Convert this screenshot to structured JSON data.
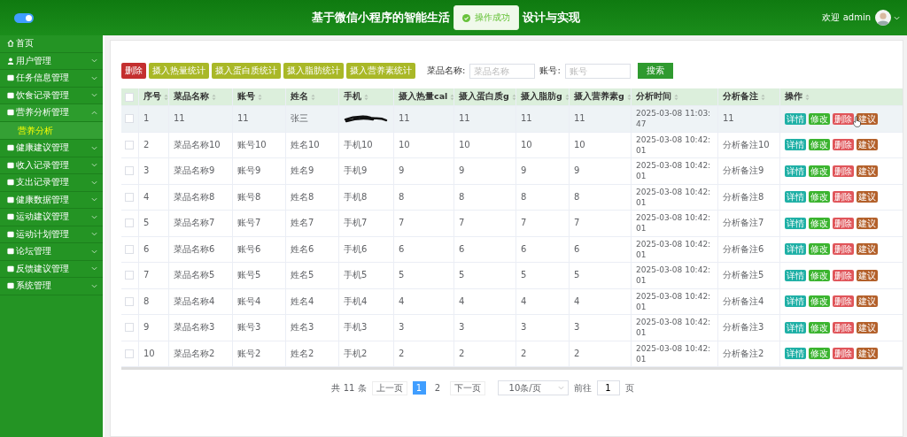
{
  "header": {
    "toggle_on": true,
    "title_left": "基于微信小程序的智能生活",
    "title_right": "设计与实现",
    "toast": "操作成功",
    "welcome": "欢迎 admin"
  },
  "sidebar": {
    "items": [
      {
        "label": "首页",
        "kind": "link"
      },
      {
        "label": "用户管理",
        "kind": "group",
        "expanded": false
      },
      {
        "label": "任务信息管理",
        "kind": "group",
        "expanded": false
      },
      {
        "label": "饮食记录管理",
        "kind": "group",
        "expanded": false
      },
      {
        "label": "营养分析管理",
        "kind": "group",
        "expanded": true,
        "children": [
          {
            "label": "营养分析",
            "selected": true
          }
        ]
      },
      {
        "label": "健康建议管理",
        "kind": "group",
        "expanded": false
      },
      {
        "label": "收入记录管理",
        "kind": "group",
        "expanded": false
      },
      {
        "label": "支出记录管理",
        "kind": "group",
        "expanded": false
      },
      {
        "label": "健康数据管理",
        "kind": "group",
        "expanded": false
      },
      {
        "label": "运动建议管理",
        "kind": "group",
        "expanded": false
      },
      {
        "label": "运动计划管理",
        "kind": "group",
        "expanded": false
      },
      {
        "label": "论坛管理",
        "kind": "group",
        "expanded": false
      },
      {
        "label": "反馈建议管理",
        "kind": "group",
        "expanded": false
      },
      {
        "label": "系统管理",
        "kind": "group",
        "expanded": false
      }
    ]
  },
  "toolbar": {
    "buttons": [
      {
        "label": "删除",
        "color": "#c42f2f"
      },
      {
        "label": "摄入热量统计",
        "color": "#a9b827"
      },
      {
        "label": "摄入蛋白质统计",
        "color": "#a9b827"
      },
      {
        "label": "摄入脂肪统计",
        "color": "#a9b827"
      },
      {
        "label": "摄入营养素统计",
        "color": "#a9b827"
      }
    ],
    "filters": [
      {
        "label": "菜品名称:",
        "placeholder": "菜品名称"
      },
      {
        "label": "账号:",
        "placeholder": "账号"
      }
    ],
    "search_button": "搜索"
  },
  "table": {
    "select_all_checked": false,
    "columns": [
      "序号",
      "菜品名称",
      "账号",
      "姓名",
      "手机",
      "摄入热量cal",
      "摄入蛋白质g",
      "摄入脂肪g",
      "摄入营养素g",
      "分析时间",
      "分析备注",
      "操作"
    ],
    "rows": [
      {
        "checked": false,
        "highlighted": true,
        "redacted": true,
        "cells": [
          "1",
          "11",
          "11",
          "张三",
          null,
          "11",
          "11",
          "11",
          "11",
          "2025-03-08 11:03:47",
          "11"
        ],
        "actions": [
          {
            "label": "详情",
            "color": "#1fb0a6"
          },
          {
            "label": "修改",
            "color": "#3bb42f"
          },
          {
            "label": "删除",
            "color": "#e0555a"
          },
          {
            "label": "建议",
            "color": "#b3602a"
          }
        ]
      },
      {
        "checked": false,
        "highlighted": false,
        "redacted": false,
        "cells": [
          "2",
          "菜品名称10",
          "账号10",
          "姓名10",
          "手机10",
          "10",
          "10",
          "10",
          "10",
          "2025-03-08 10:42:01",
          "分析备注10"
        ],
        "actions": [
          {
            "label": "详情",
            "color": "#1fb0a6"
          },
          {
            "label": "修改",
            "color": "#3bb42f"
          },
          {
            "label": "删除",
            "color": "#e0555a"
          },
          {
            "label": "建议",
            "color": "#b3602a"
          }
        ]
      },
      {
        "checked": false,
        "highlighted": false,
        "redacted": false,
        "cells": [
          "3",
          "菜品名称9",
          "账号9",
          "姓名9",
          "手机9",
          "9",
          "9",
          "9",
          "9",
          "2025-03-08 10:42:01",
          "分析备注9"
        ],
        "actions": [
          {
            "label": "详情",
            "color": "#1fb0a6"
          },
          {
            "label": "修改",
            "color": "#3bb42f"
          },
          {
            "label": "删除",
            "color": "#e0555a"
          },
          {
            "label": "建议",
            "color": "#b3602a"
          }
        ]
      },
      {
        "checked": false,
        "highlighted": false,
        "redacted": false,
        "cells": [
          "4",
          "菜品名称8",
          "账号8",
          "姓名8",
          "手机8",
          "8",
          "8",
          "8",
          "8",
          "2025-03-08 10:42:01",
          "分析备注8"
        ],
        "actions": [
          {
            "label": "详情",
            "color": "#1fb0a6"
          },
          {
            "label": "修改",
            "color": "#3bb42f"
          },
          {
            "label": "删除",
            "color": "#e0555a"
          },
          {
            "label": "建议",
            "color": "#b3602a"
          }
        ]
      },
      {
        "checked": false,
        "highlighted": false,
        "redacted": false,
        "cells": [
          "5",
          "菜品名称7",
          "账号7",
          "姓名7",
          "手机7",
          "7",
          "7",
          "7",
          "7",
          "2025-03-08 10:42:01",
          "分析备注7"
        ],
        "actions": [
          {
            "label": "详情",
            "color": "#1fb0a6"
          },
          {
            "label": "修改",
            "color": "#3bb42f"
          },
          {
            "label": "删除",
            "color": "#e0555a"
          },
          {
            "label": "建议",
            "color": "#b3602a"
          }
        ]
      },
      {
        "checked": false,
        "highlighted": false,
        "redacted": false,
        "cells": [
          "6",
          "菜品名称6",
          "账号6",
          "姓名6",
          "手机6",
          "6",
          "6",
          "6",
          "6",
          "2025-03-08 10:42:01",
          "分析备注6"
        ],
        "actions": [
          {
            "label": "详情",
            "color": "#1fb0a6"
          },
          {
            "label": "修改",
            "color": "#3bb42f"
          },
          {
            "label": "删除",
            "color": "#e0555a"
          },
          {
            "label": "建议",
            "color": "#b3602a"
          }
        ]
      },
      {
        "checked": false,
        "highlighted": false,
        "redacted": false,
        "cells": [
          "7",
          "菜品名称5",
          "账号5",
          "姓名5",
          "手机5",
          "5",
          "5",
          "5",
          "5",
          "2025-03-08 10:42:01",
          "分析备注5"
        ],
        "actions": [
          {
            "label": "详情",
            "color": "#1fb0a6"
          },
          {
            "label": "修改",
            "color": "#3bb42f"
          },
          {
            "label": "删除",
            "color": "#e0555a"
          },
          {
            "label": "建议",
            "color": "#b3602a"
          }
        ]
      },
      {
        "checked": false,
        "highlighted": false,
        "redacted": false,
        "cells": [
          "8",
          "菜品名称4",
          "账号4",
          "姓名4",
          "手机4",
          "4",
          "4",
          "4",
          "4",
          "2025-03-08 10:42:01",
          "分析备注4"
        ],
        "actions": [
          {
            "label": "详情",
            "color": "#1fb0a6"
          },
          {
            "label": "修改",
            "color": "#3bb42f"
          },
          {
            "label": "删除",
            "color": "#e0555a"
          },
          {
            "label": "建议",
            "color": "#b3602a"
          }
        ]
      },
      {
        "checked": false,
        "highlighted": false,
        "redacted": false,
        "cells": [
          "9",
          "菜品名称3",
          "账号3",
          "姓名3",
          "手机3",
          "3",
          "3",
          "3",
          "3",
          "2025-03-08 10:42:01",
          "分析备注3"
        ],
        "actions": [
          {
            "label": "详情",
            "color": "#1fb0a6"
          },
          {
            "label": "修改",
            "color": "#3bb42f"
          },
          {
            "label": "删除",
            "color": "#e0555a"
          },
          {
            "label": "建议",
            "color": "#b3602a"
          }
        ]
      },
      {
        "checked": false,
        "highlighted": false,
        "redacted": false,
        "cells": [
          "10",
          "菜品名称2",
          "账号2",
          "姓名2",
          "手机2",
          "2",
          "2",
          "2",
          "2",
          "2025-03-08 10:42:01",
          "分析备注2"
        ],
        "actions": [
          {
            "label": "详情",
            "color": "#1fb0a6"
          },
          {
            "label": "修改",
            "color": "#3bb42f"
          },
          {
            "label": "删除",
            "color": "#e0555a"
          },
          {
            "label": "建议",
            "color": "#b3602a"
          }
        ]
      }
    ]
  },
  "pagination": {
    "total": "共 11 条",
    "prev": "上一页",
    "pages": [
      {
        "label": "1",
        "selected": true
      },
      {
        "label": "2",
        "selected": false
      }
    ],
    "next": "下一页",
    "page_size": "10条/页",
    "goto": "前往",
    "goto_value": "1",
    "page_unit": "页"
  }
}
